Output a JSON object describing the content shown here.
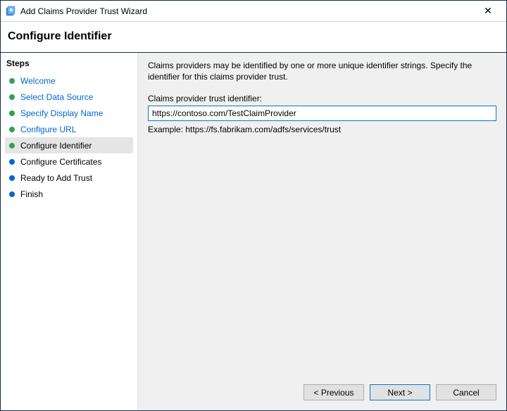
{
  "titlebar": {
    "title": "Add Claims Provider Trust Wizard",
    "close_glyph": "✕"
  },
  "header": {
    "title": "Configure Identifier"
  },
  "sidebar": {
    "heading": "Steps",
    "items": [
      {
        "label": "Welcome",
        "state": "completed"
      },
      {
        "label": "Select Data Source",
        "state": "completed"
      },
      {
        "label": "Specify Display Name",
        "state": "completed"
      },
      {
        "label": "Configure URL",
        "state": "completed"
      },
      {
        "label": "Configure Identifier",
        "state": "current"
      },
      {
        "label": "Configure Certificates",
        "state": "pending"
      },
      {
        "label": "Ready to Add Trust",
        "state": "pending"
      },
      {
        "label": "Finish",
        "state": "pending"
      }
    ]
  },
  "main": {
    "instruction": "Claims providers may be identified by one or more unique identifier strings. Specify the identifier for this claims provider trust.",
    "identifier_label": "Claims provider trust identifier:",
    "identifier_value": "https://contoso.com/TestClaimProvider",
    "example_text": "Example: https://fs.fabrikam.com/adfs/services/trust"
  },
  "buttons": {
    "previous": "< Previous",
    "next": "Next >",
    "cancel": "Cancel"
  }
}
